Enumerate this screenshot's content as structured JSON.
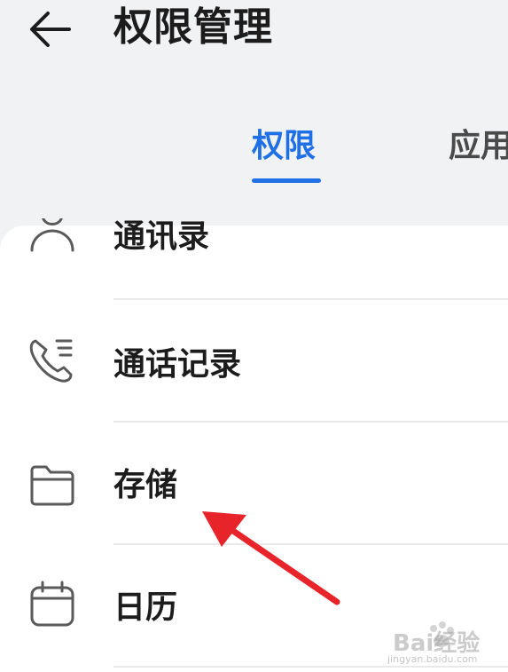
{
  "header": {
    "title": "权限管理",
    "back_icon": "arrow-left-icon"
  },
  "tabs": [
    {
      "label": "权限",
      "selected": true
    },
    {
      "label": "应用",
      "selected": false
    }
  ],
  "list": {
    "items": [
      {
        "label": "通讯录",
        "icon": "contacts-icon"
      },
      {
        "label": "通话记录",
        "icon": "call-log-icon"
      },
      {
        "label": "存储",
        "icon": "folder-icon"
      },
      {
        "label": "日历",
        "icon": "calendar-icon"
      }
    ]
  },
  "annotation": {
    "arrow_color": "#e8242b"
  },
  "watermark": {
    "text": "Bai经验",
    "sub": "jingyan.baidu.com"
  },
  "colors": {
    "accent": "#1f6fe6",
    "background": "#f1f2f4",
    "card": "#ffffff"
  }
}
